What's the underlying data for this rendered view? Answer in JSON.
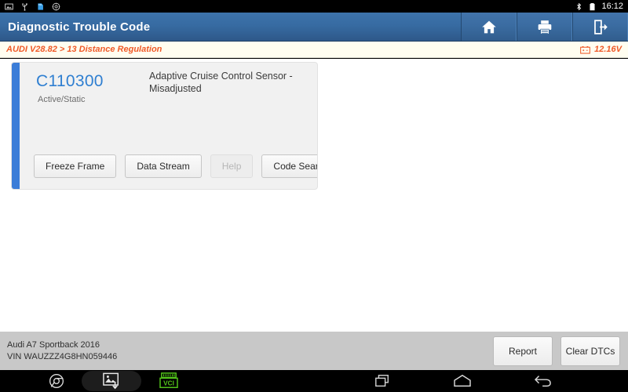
{
  "statusbar": {
    "left_icons": [
      "screenshot-icon",
      "usb-icon",
      "sd-card-icon",
      "settings-icon"
    ],
    "bluetooth_icon": "bluetooth-icon",
    "battery_icon": "battery-icon",
    "time": "16:12"
  },
  "titlebar": {
    "title": "Diagnostic Trouble Code",
    "buttons": [
      {
        "name": "home-button",
        "icon": "home-icon"
      },
      {
        "name": "print-button",
        "icon": "printer-icon"
      },
      {
        "name": "exit-button",
        "icon": "exit-icon"
      }
    ]
  },
  "infobar": {
    "breadcrumb": "AUDI V28.82 > 13 Distance Regulation",
    "battery_icon": "battery-voltage-icon",
    "voltage": "12.16V"
  },
  "dtc": {
    "code": "C110300",
    "status": "Active/Static",
    "description": "Adaptive Cruise Control Sensor - Misadjusted",
    "accent_color": "#3b7dd8",
    "code_color": "#2f7fd1",
    "buttons": [
      {
        "label": "Freeze Frame",
        "name": "freeze-frame-button",
        "disabled": false
      },
      {
        "label": "Data Stream",
        "name": "data-stream-button",
        "disabled": false
      },
      {
        "label": "Help",
        "name": "help-button",
        "disabled": true
      },
      {
        "label": "Code Search",
        "name": "code-search-button",
        "disabled": false
      }
    ]
  },
  "footer": {
    "vehicle": "Audi A7 Sportback 2016",
    "vin": "VIN WAUZZZ4G8HN059446",
    "report_label": "Report",
    "clear_label": "Clear DTCs"
  },
  "navbar": {
    "browser_icon": "browser-icon",
    "screenshot_icon": "screenshot-capture-icon",
    "vci_icon": "vci-icon",
    "vci_label": "VCI",
    "vci_color": "#52c41a",
    "recents_icon": "recents-icon",
    "home_icon": "home-outline-icon",
    "back_icon": "back-icon"
  }
}
